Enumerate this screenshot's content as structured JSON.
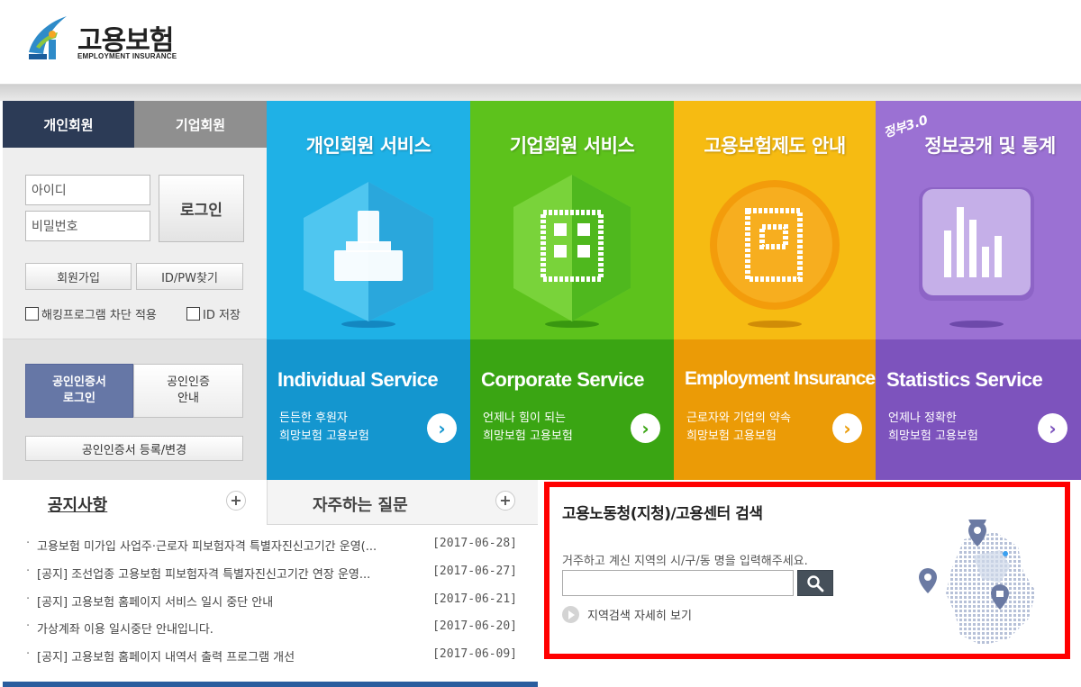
{
  "header": {
    "logo_text": "고용보험",
    "logo_sub": "EMPLOYMENT INSURANCE"
  },
  "login": {
    "tab_personal": "개인회원",
    "tab_corporate": "기업회원",
    "id_placeholder": "아이디",
    "pw_placeholder": "비밀번호",
    "login_button": "로그인",
    "join_button": "회원가입",
    "find_button": "ID/PW찾기",
    "checkbox_hacking": "해킹프로그램 차단 적용",
    "checkbox_save_id": "ID 저장",
    "cert_login_line1": "공인인증서",
    "cert_login_line2": "로그인",
    "cert_info_line1": "공인인증",
    "cert_info_line2": "안내",
    "cert_register": "공인인증서 등록/변경"
  },
  "tiles": [
    {
      "title": "개인회원 서비스",
      "en": "Individual Service",
      "desc1": "든든한 후원자",
      "desc2": "희망보험 고용보험"
    },
    {
      "title": "기업회원 서비스",
      "en": "Corporate Service",
      "desc1": "언제나 힘이 되는",
      "desc2": "희망보험 고용보험"
    },
    {
      "title": "고용보험제도 안내",
      "en": "Employment Insurance",
      "desc1": "근로자와 기업의 약속",
      "desc2": "희망보험 고용보험"
    },
    {
      "title": "정보공개 및 통계",
      "badge": "정부3.0",
      "en": "Statistics Service",
      "desc1": "언제나 정확한",
      "desc2": "희망보험 고용보험"
    }
  ],
  "notice": {
    "tab_notice": "공지사항",
    "tab_faq": "자주하는 질문",
    "plus": "+",
    "items": [
      {
        "text": "고용보험 미가입 사업주·근로자 피보험자격 특별자진신고기간 운영(...",
        "date": "[2017-06-28]"
      },
      {
        "text": "[공지] 조선업종 고용보험 피보험자격 특별자진신고기간 연장 운영...",
        "date": "[2017-06-27]"
      },
      {
        "text": "[공지] 고용보험 홈페이지 서비스 일시 중단 안내",
        "date": "[2017-06-21]"
      },
      {
        "text": "가상계좌 이용 일시중단 안내입니다.",
        "date": "[2017-06-20]"
      },
      {
        "text": "[공지] 고용보험 홈페이지 내역서 출력 프로그램 개선",
        "date": "[2017-06-09]"
      }
    ]
  },
  "search": {
    "title": "고용노동청(지청)/고용센터 검색",
    "guide": "거주하고 계신 지역의 시/구/동 명을 입력해주세요.",
    "input_value": "",
    "more": "지역검색 자세히 보기"
  },
  "colors": {
    "individual": "#1fb1e6",
    "corporate": "#5dc21c",
    "insurance": "#f6bb12",
    "statistics": "#9b71d3",
    "highlight": "#ff0000"
  }
}
